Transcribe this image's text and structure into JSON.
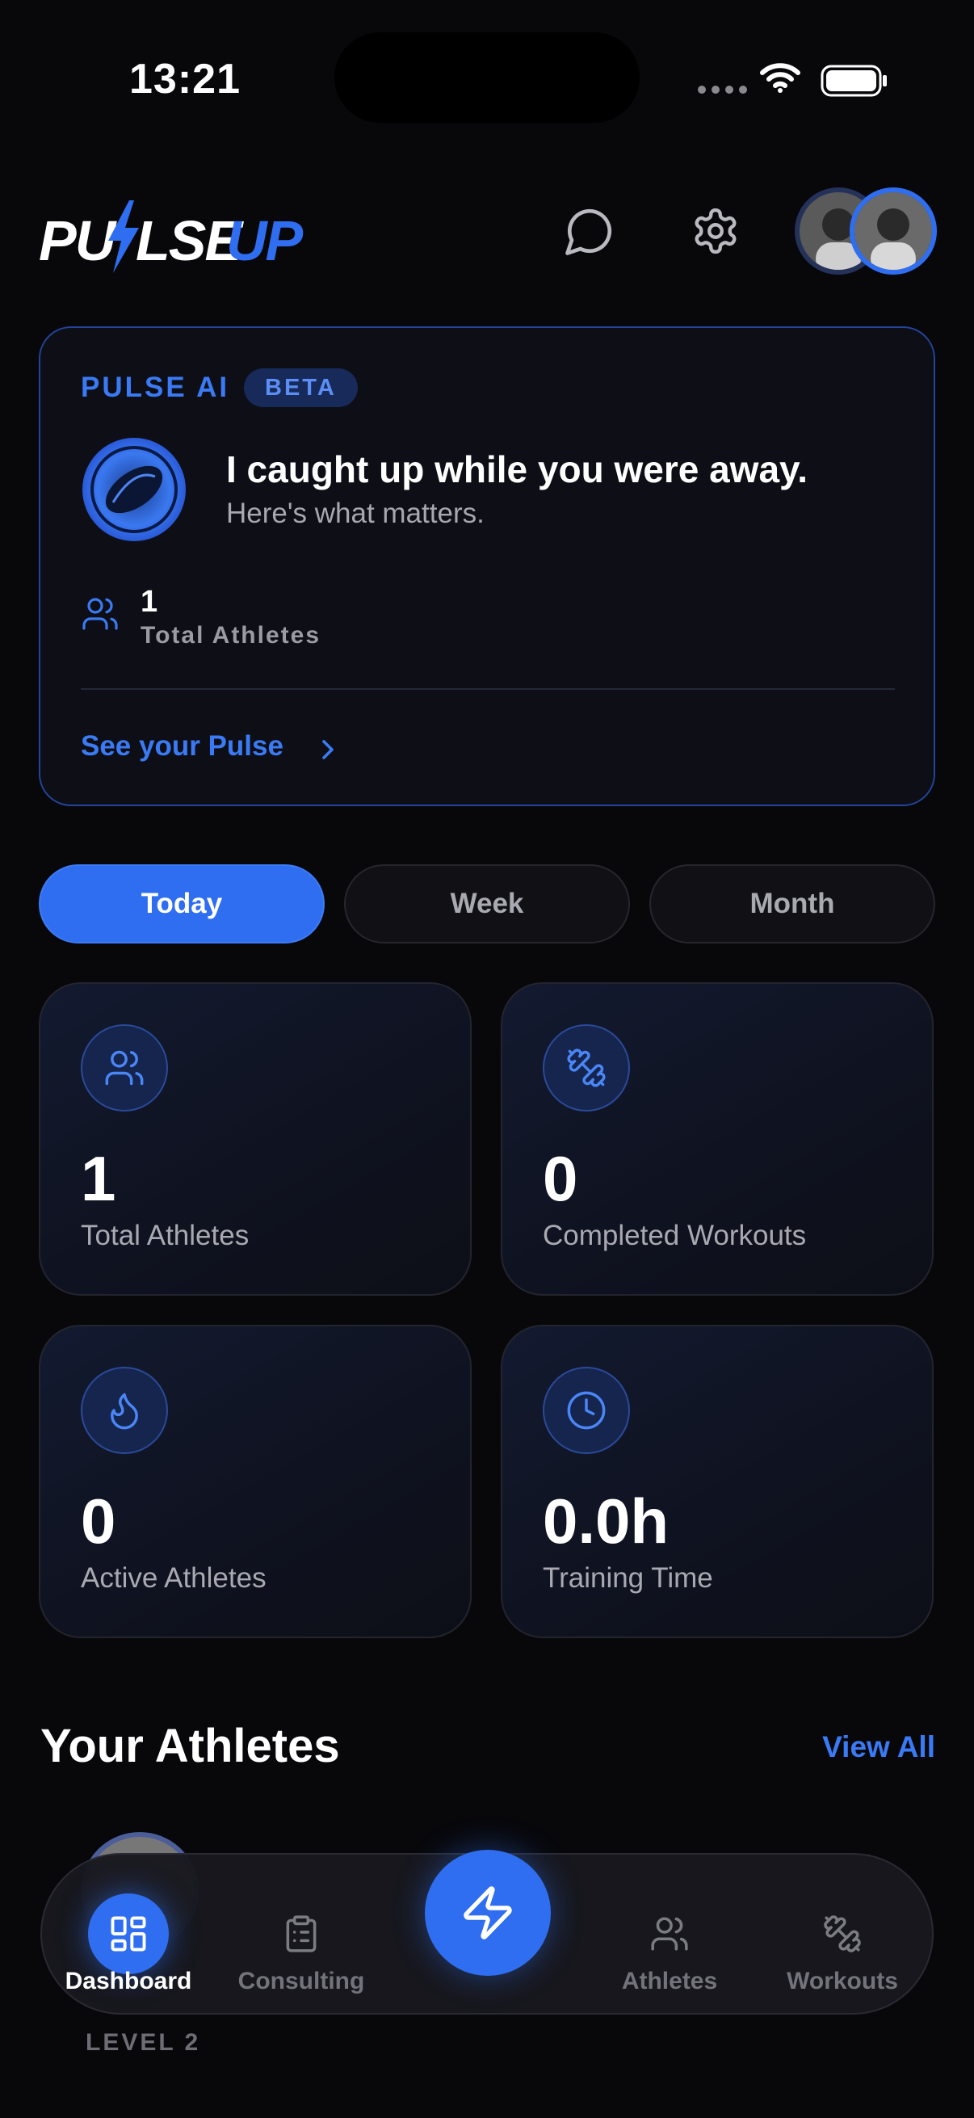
{
  "status_bar": {
    "time": "13:21"
  },
  "header": {
    "logo_text_white": "PULSE",
    "logo_text_blue": "UP"
  },
  "ai_card": {
    "title": "PULSE AI",
    "badge": "BETA",
    "headline": "I caught up while you were away.",
    "subtitle": "Here's what matters.",
    "stat_value": "1",
    "stat_label": "Total Athletes",
    "link_label": "See your Pulse"
  },
  "period_tabs": [
    {
      "label": "Today",
      "active": true
    },
    {
      "label": "Week",
      "active": false
    },
    {
      "label": "Month",
      "active": false
    }
  ],
  "stats": [
    {
      "value": "1",
      "label": "Total Athletes",
      "icon": "users-icon"
    },
    {
      "value": "0",
      "label": "Completed Workouts",
      "icon": "dumbbell-icon"
    },
    {
      "value": "0",
      "label": "Active Athletes",
      "icon": "flame-icon"
    },
    {
      "value": "0.0h",
      "label": "Training Time",
      "icon": "clock-icon"
    }
  ],
  "athletes_section": {
    "title": "Your Athletes",
    "view_all": "View All",
    "level_label": "LEVEL 2"
  },
  "bottom_nav": [
    {
      "label": "Dashboard",
      "icon": "grid-icon",
      "active": true
    },
    {
      "label": "Consulting",
      "icon": "clipboard-icon",
      "active": false
    },
    {
      "label": "Athletes",
      "icon": "users-icon",
      "active": false
    },
    {
      "label": "Workouts",
      "icon": "dumbbell-icon",
      "active": false
    }
  ],
  "colors": {
    "accent": "#2f6ef0",
    "background": "#08080b",
    "card": "#0e0f16"
  }
}
